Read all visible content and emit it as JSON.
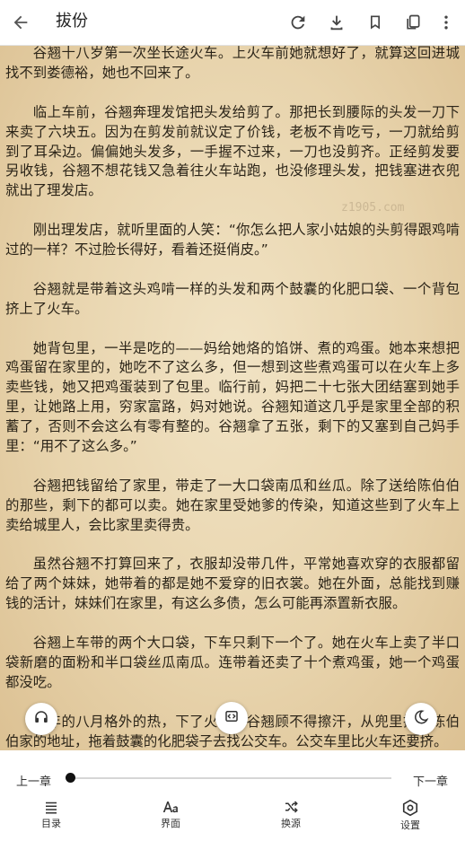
{
  "header": {
    "title": "拔份"
  },
  "content": {
    "paragraphs": [
      "谷翘十八岁第一次坐长途火车。上火车前她就想好了，就算这回进城找不到娄德裕，她也不回来了。",
      "临上车前，谷翘奔理发馆把头发给剪了。那把长到腰际的头发一刀下来卖了六块五。因为在剪发前就议定了价钱，老板不肯吃亏，一刀就给剪到了耳朵边。偏偏她头发多，一手握不过来，一刀也没剪齐。正经剪发要另收钱，谷翘不想花钱又急着往火车站跑，也没修理头发，把钱塞进衣兜就出了理发店。",
      "刚出理发店，就听里面的人笑：“你怎么把人家小姑娘的头剪得跟鸡啃过的一样？不过脸长得好，看着还挺俏皮。”",
      "谷翘就是带着这头鸡啃一样的头发和两个鼓囊的化肥口袋、一个背包挤上了火车。",
      "她背包里，一半是吃的——妈给她烙的馅饼、煮的鸡蛋。她本来想把鸡蛋留在家里的，她吃不了这么多，但一想到这些煮鸡蛋可以在火车上多卖些钱，她又把鸡蛋装到了包里。临行前，妈把二十七张大团结塞到她手里，让她路上用，穷家富路，妈对她说。谷翘知道这几乎是家里全部的积蓄了，否则不会这么有零有整的。谷翘拿了五张，剩下的又塞到自己妈手里：“用不了这么多。”",
      "谷翘把钱留给了家里，带走了一大口袋南瓜和丝瓜。除了送给陈伯伯的那些，剩下的都可以卖。她在家里受她爹的传染，知道这些到了火车上卖给城里人，会比家里卖得贵。",
      "虽然谷翘不打算回来了，衣服却没带几件，平常她喜欢穿的衣服都留给了两个妹妹，她带着的都是她不爱穿的旧衣裳。她在外面，总能找到赚钱的活计，妹妹们在家里，有这么多债，怎么可能再添置新衣服。",
      "谷翘上车带的两个大口袋，下车只剩下一个了。她在火车上卖了半口袋新磨的面粉和半口袋丝瓜南瓜。连带着还卖了十个煮鸡蛋，她一个鸡蛋都没吃。",
      "今年的八月格外的热，下了火车，谷翘顾不得擦汗，从兜里掏出陈伯伯家的地址，拖着鼓囊的化肥袋子去找公交车。公交车里比火车还要挤。"
    ],
    "watermark": "z1905.com"
  },
  "progress": {
    "prev_label": "上一章",
    "next_label": "下一章",
    "position": 0.0
  },
  "bottom_nav": [
    {
      "label": "目录",
      "icon": "list-icon"
    },
    {
      "label": "界面",
      "icon": "font-icon"
    },
    {
      "label": "换源",
      "icon": "shuffle-icon"
    },
    {
      "label": "设置",
      "icon": "settings-icon"
    }
  ],
  "icons": {
    "back": "back-arrow-icon",
    "refresh": "refresh-icon",
    "download": "download-icon",
    "bookmark": "bookmark-icon",
    "copy": "copy-icon",
    "more": "more-vert-icon",
    "tts": "headphones-icon",
    "autopage": "auto-page-icon",
    "night": "moon-icon"
  }
}
